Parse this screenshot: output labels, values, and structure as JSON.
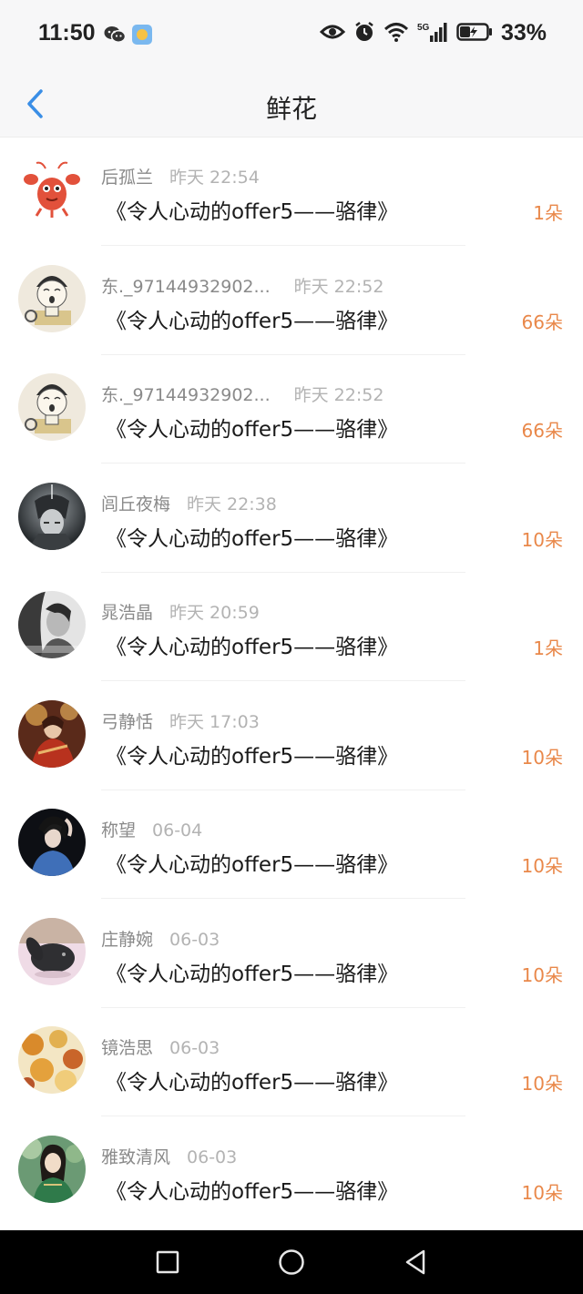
{
  "status_bar": {
    "time": "11:50",
    "battery_percent": "33%",
    "network": "5G"
  },
  "header": {
    "title": "鲜花"
  },
  "items": [
    {
      "username": "后孤兰",
      "time": "昨天 22:54",
      "title": "《令人心动的offer5——骆律》",
      "count": "1朵",
      "avatar": "lobster-avatar"
    },
    {
      "username": "东._97144932902...",
      "time": "昨天 22:52",
      "title": "《令人心动的offer5——骆律》",
      "count": "66朵",
      "avatar": "cartoon-cat-avatar"
    },
    {
      "username": "东._97144932902...",
      "time": "昨天 22:52",
      "title": "《令人心动的offer5——骆律》",
      "count": "66朵",
      "avatar": "cartoon-cat-avatar"
    },
    {
      "username": "闾丘夜梅",
      "time": "昨天 22:38",
      "title": "《令人心动的offer5——骆律》",
      "count": "10朵",
      "avatar": "dark-character-avatar"
    },
    {
      "username": "晁浩晶",
      "time": "昨天 20:59",
      "title": "《令人心动的offer5——骆律》",
      "count": "1朵",
      "avatar": "bw-portrait-avatar"
    },
    {
      "username": "弓静恬",
      "time": "昨天 17:03",
      "title": "《令人心动的offer5——骆律》",
      "count": "10朵",
      "avatar": "red-painting-avatar"
    },
    {
      "username": "称望",
      "time": "06-04",
      "title": "《令人心动的offer5——骆律》",
      "count": "10朵",
      "avatar": "girl-blue-avatar"
    },
    {
      "username": "庄静婉",
      "time": "06-03",
      "title": "《令人心动的offer5——骆律》",
      "count": "10朵",
      "avatar": "rabbit-avatar"
    },
    {
      "username": "镜浩思",
      "time": "06-03",
      "title": "《令人心动的offer5——骆律》",
      "count": "10朵",
      "avatar": "autumn-leaves-avatar"
    },
    {
      "username": "雅致清风",
      "time": "06-03",
      "title": "《令人心动的offer5——骆律》",
      "count": "10朵",
      "avatar": "girl-green-avatar"
    }
  ],
  "colors": {
    "accent_back": "#3a8ee6",
    "count_orange": "#e9884a",
    "username_gray": "#8a8a8a",
    "time_gray": "#b3b3b3"
  }
}
